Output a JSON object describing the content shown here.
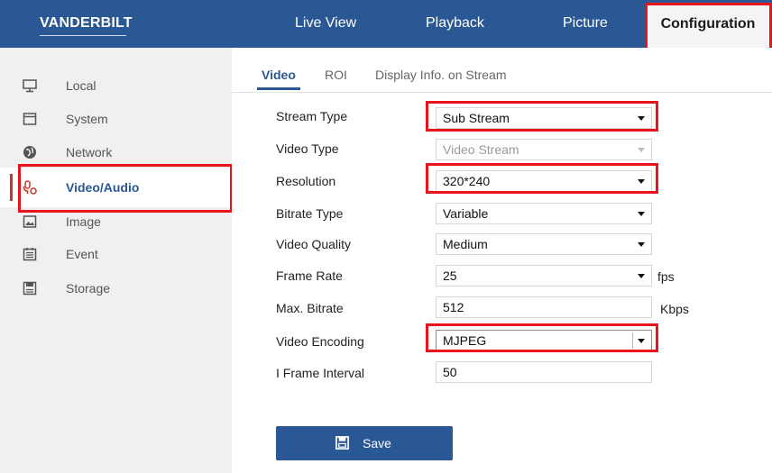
{
  "brand": {
    "logo_text": "VANDERBILT"
  },
  "top_nav": {
    "live_view": "Live View",
    "playback": "Playback",
    "picture": "Picture",
    "configuration": "Configuration"
  },
  "sidebar": {
    "items": [
      {
        "label": "Local",
        "icon": "monitor-icon"
      },
      {
        "label": "System",
        "icon": "window-icon"
      },
      {
        "label": "Network",
        "icon": "globe-icon"
      },
      {
        "label": "Video/Audio",
        "icon": "microphone-settings-icon"
      },
      {
        "label": "Image",
        "icon": "image-icon"
      },
      {
        "label": "Event",
        "icon": "calendar-icon"
      },
      {
        "label": "Storage",
        "icon": "storage-icon"
      }
    ],
    "active": "Video/Audio"
  },
  "tabs": {
    "video": "Video",
    "roi": "ROI",
    "display_info": "Display Info. on Stream"
  },
  "form": {
    "stream_type": {
      "label": "Stream Type",
      "value": "Sub Stream"
    },
    "video_type": {
      "label": "Video Type",
      "value": "Video Stream"
    },
    "resolution": {
      "label": "Resolution",
      "value": "320*240"
    },
    "bitrate_type": {
      "label": "Bitrate Type",
      "value": "Variable"
    },
    "video_quality": {
      "label": "Video Quality",
      "value": "Medium"
    },
    "frame_rate": {
      "label": "Frame Rate",
      "value": "25",
      "unit": "fps"
    },
    "max_bitrate": {
      "label": "Max. Bitrate",
      "value": "512",
      "unit": "Kbps"
    },
    "video_encoding": {
      "label": "Video Encoding",
      "value": "MJPEG"
    },
    "i_frame_interval": {
      "label": "I Frame Interval",
      "value": "50"
    }
  },
  "actions": {
    "save": "Save"
  },
  "colors": {
    "nav_bar": "#2a5894",
    "highlight": "#e8131b",
    "sidebar_bg": "#f0f0f0",
    "accent": "#2a5894"
  }
}
